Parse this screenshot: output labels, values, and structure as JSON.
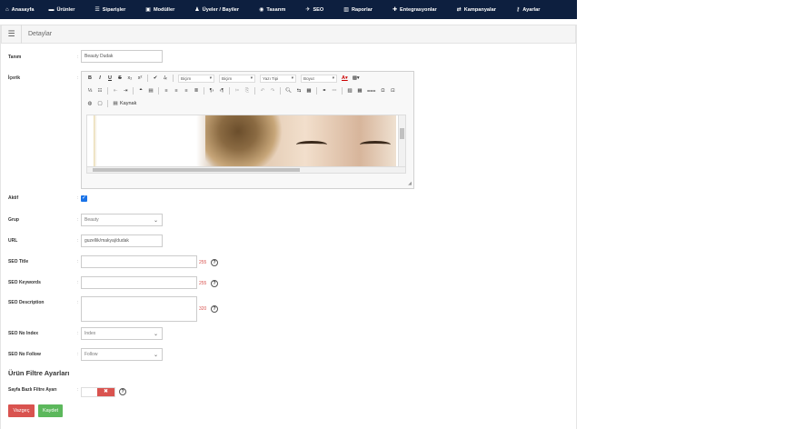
{
  "nav": [
    {
      "icon": "home-icon",
      "glyph": "⌂",
      "label": "Anasayfa"
    },
    {
      "icon": "folder-icon",
      "glyph": "▬",
      "label": "Ürünler"
    },
    {
      "icon": "list-icon",
      "glyph": "☰",
      "label": "Siparişler"
    },
    {
      "icon": "module-icon",
      "glyph": "▣",
      "label": "Modüller"
    },
    {
      "icon": "users-icon",
      "glyph": "♟",
      "label": "Üyeler / Bayiler"
    },
    {
      "icon": "eye-icon",
      "glyph": "◉",
      "label": "Tasarım"
    },
    {
      "icon": "rocket-icon",
      "glyph": "✈",
      "label": "SEO"
    },
    {
      "icon": "chart-icon",
      "glyph": "▥",
      "label": "Raporlar"
    },
    {
      "icon": "puzzle-icon",
      "glyph": "✚",
      "label": "Entegrasyonlar"
    },
    {
      "icon": "exchange-icon",
      "glyph": "⇄",
      "label": "Kampanyalar"
    },
    {
      "icon": "key-icon",
      "glyph": "⚷",
      "label": "Ayarlar"
    }
  ],
  "card": {
    "title": "Detaylar"
  },
  "form": {
    "name_label": "Tanım",
    "name_value": "Beauty Dudak",
    "content_label": "İçerik",
    "editor": {
      "format_combo": "Biçim",
      "style_combo": "Biçim",
      "font_combo": "Yazı Tipi",
      "size_combo": "Boyut",
      "source_label": "Kaynak"
    },
    "active_label": "Aktif",
    "active_checked": true,
    "group_label": "Grup",
    "group_value": "Beauty",
    "url_label": "URL",
    "url_value": "guzellik/makyaj/dudak",
    "seo_title_label": "SEO Title",
    "seo_title_count": "255",
    "seo_keywords_label": "SEO Keywords",
    "seo_keywords_count": "255",
    "seo_description_label": "SEO Description",
    "seo_description_count": "320",
    "seo_noindex_label": "SEO No Index",
    "seo_noindex_value": "Index",
    "seo_nofollow_label": "SEO No Follow",
    "seo_nofollow_value": "Follow",
    "filter_section_title": "Ürün Filtre Ayarları",
    "page_filter_label": "Sayfa Bazlı Filtre Ayarı",
    "toggle_symbol": "✖",
    "help_glyph": "?"
  },
  "buttons": {
    "cancel": "Vazgeç",
    "save": "Kaydet"
  }
}
